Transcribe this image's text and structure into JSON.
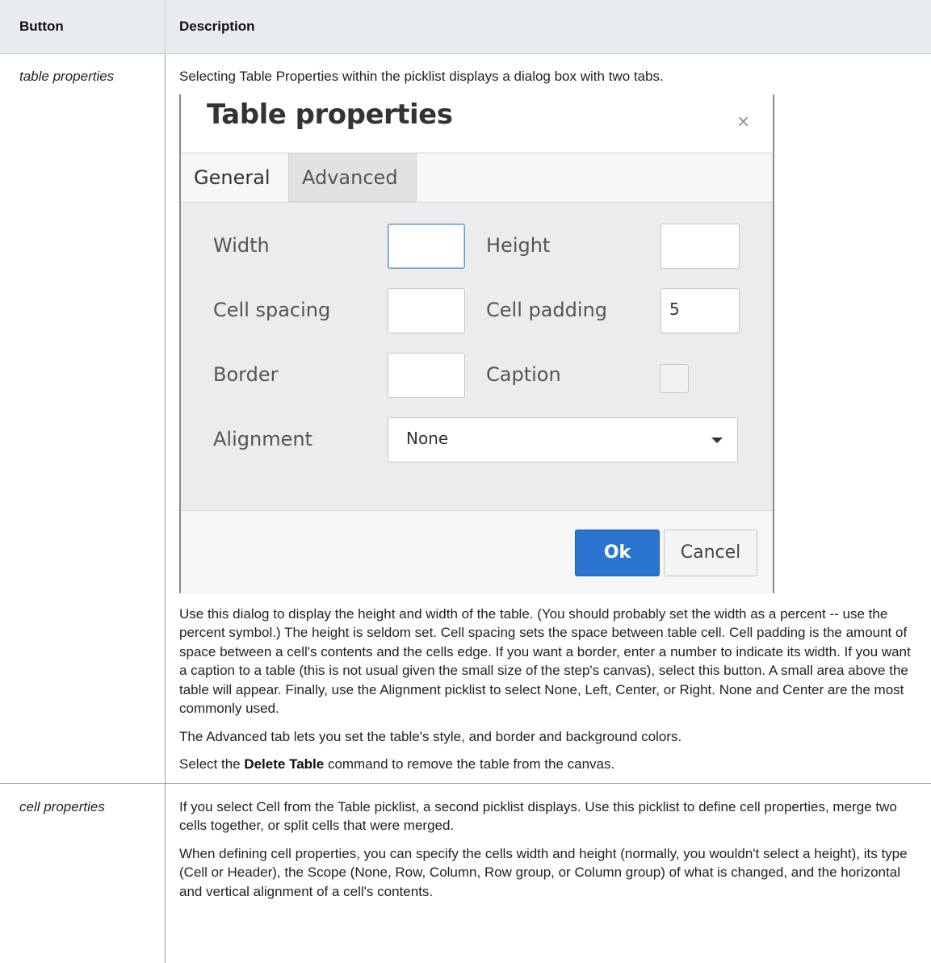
{
  "table": {
    "headers": {
      "button": "Button",
      "description": "Description"
    },
    "rows": [
      {
        "button": "table properties",
        "intro": "Selecting Table Properties within the picklist displays a dialog box with two tabs.",
        "dialog": {
          "title": "Table properties",
          "close": "×",
          "tabs": {
            "general": "General",
            "advanced": "Advanced"
          },
          "fields": {
            "width_label": "Width",
            "height_label": "Height",
            "cell_spacing_label": "Cell spacing",
            "cell_padding_label": "Cell padding",
            "cell_padding_value": "5",
            "border_label": "Border",
            "caption_label": "Caption",
            "alignment_label": "Alignment",
            "alignment_value": "None"
          },
          "buttons": {
            "ok": "Ok",
            "cancel": "Cancel"
          }
        },
        "para1": "Use this dialog to display the height and width of the table. (You should probably set the width as a percent -- use the percent symbol.) The height is seldom set. Cell spacing sets the space between table cell. Cell padding is the amount of space between a cell's contents and the cells edge. If you want a border, enter a number to indicate its width. If you want a caption to a table (this is not usual given the small size of the step's canvas), select this button. A small area above the table will appear. Finally, use the Alignment picklist to select None, Left, Center, or Right. None and Center are the most commonly used.",
        "para2": "The Advanced tab lets you set the table's style, and border and background colors.",
        "para3_before": "Select the ",
        "para3_bold": "Delete Table",
        "para3_after": " command to remove the table from the canvas."
      },
      {
        "button": "cell properties",
        "para1": "If you select Cell from the Table picklist, a second picklist displays. Use this picklist to define cell properties, merge two cells together, or split cells that were merged.",
        "para2": "When defining cell properties, you can specify the cells width and height (normally, you wouldn't select a height), its type (Cell or Header), the Scope (None, Row, Column, Row group, or Column group) of what is changed, and the horizontal and vertical alignment of a cell's contents."
      }
    ]
  }
}
